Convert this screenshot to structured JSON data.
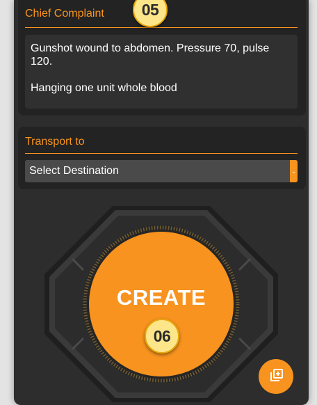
{
  "complaint": {
    "title": "Chief Complaint",
    "text": "Gunshot wound to abdomen. Pressure 70, pulse 120.\n\nHanging one unit whole blood"
  },
  "transport": {
    "title": "Transport to",
    "selected": "Select Destination"
  },
  "create_button": {
    "label": "CREATE"
  },
  "annotations": {
    "badge_1": "05",
    "badge_2": "06"
  },
  "icons": {
    "dropdown": "chevron-down-icon",
    "fab": "add-copy-icon"
  },
  "colors": {
    "accent": "#f7931e",
    "background": "#2d2d2d",
    "card": "#232323",
    "badge": "#fde68a"
  }
}
